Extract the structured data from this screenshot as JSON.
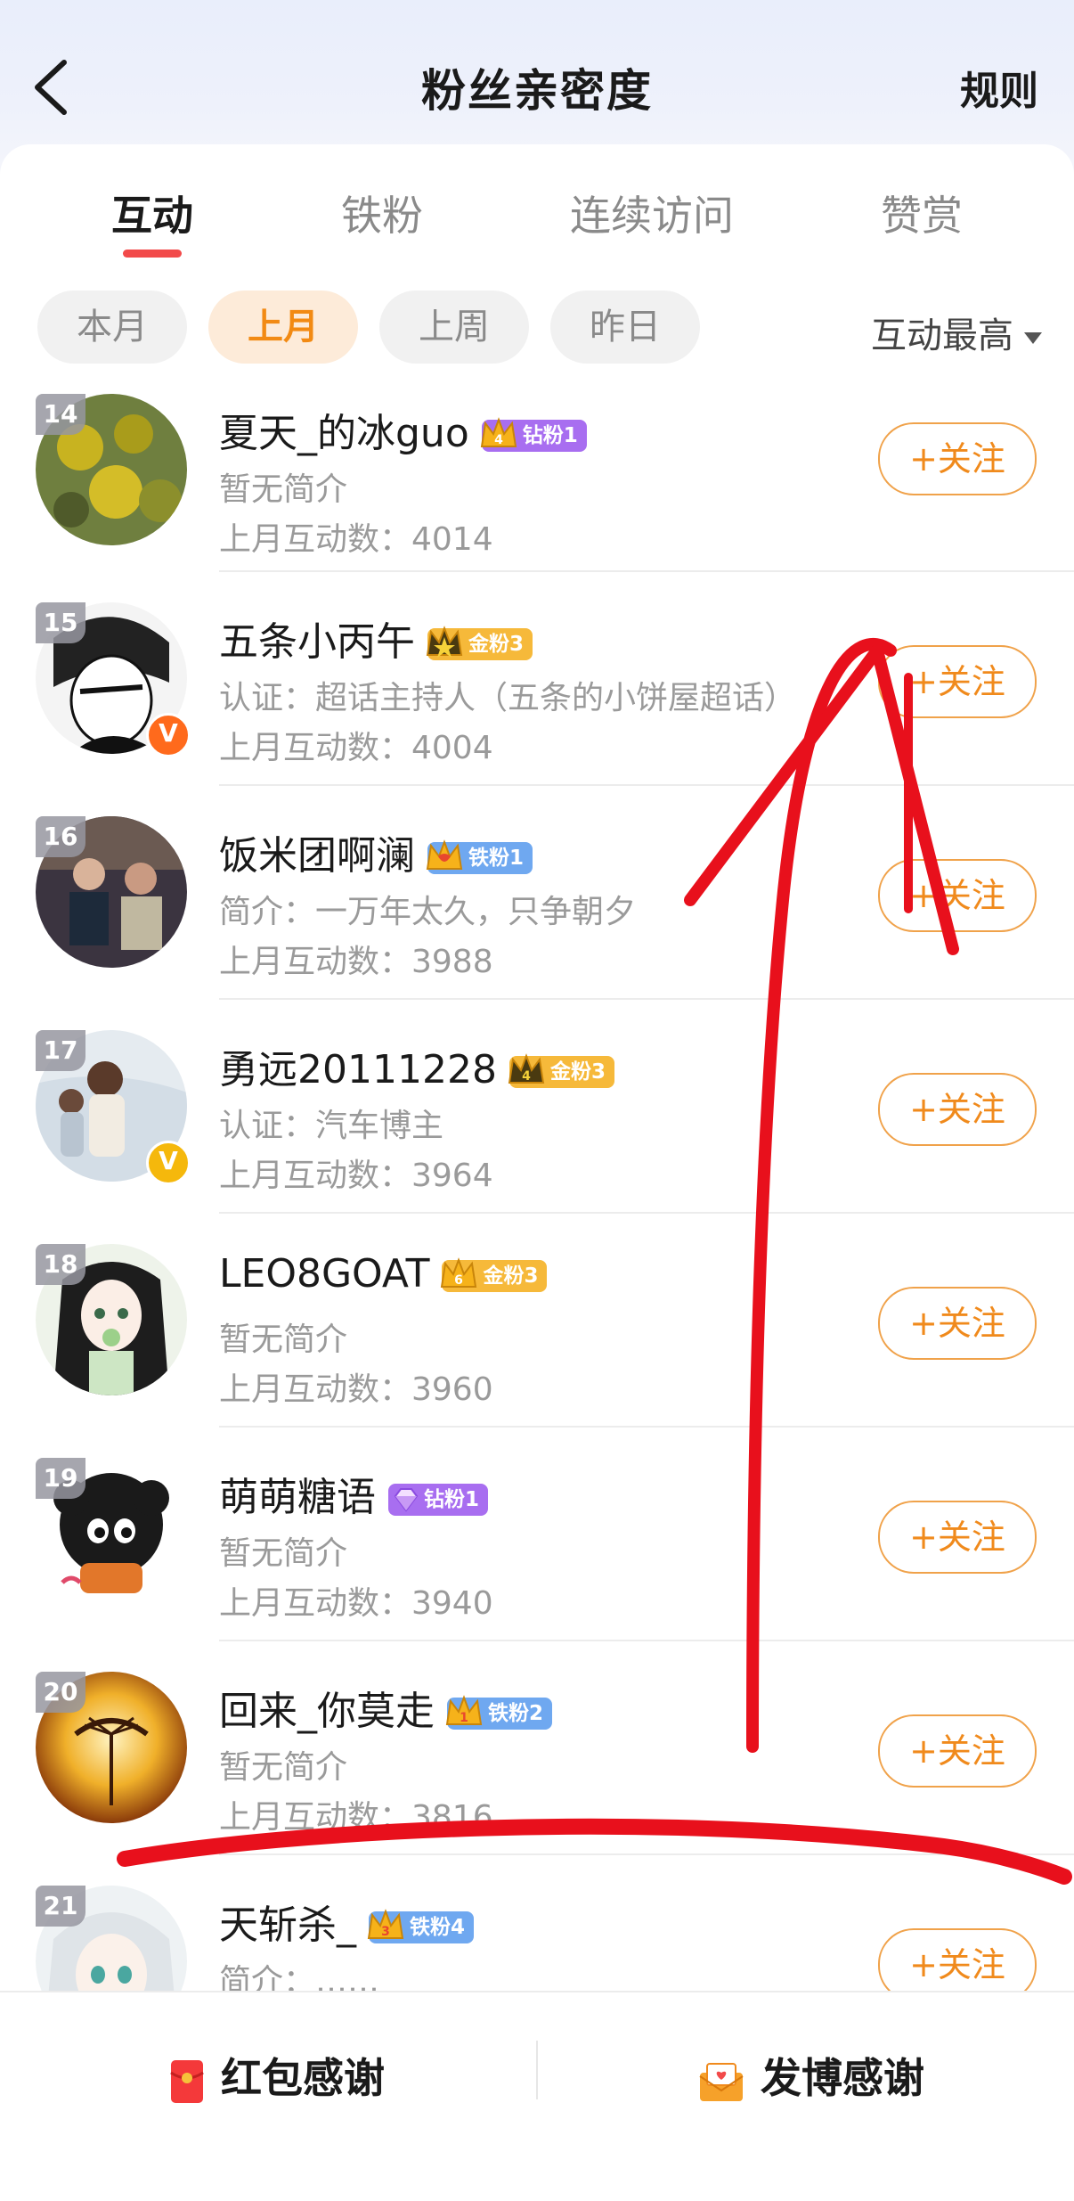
{
  "header": {
    "title": "粉丝亲密度",
    "rules_label": "规则"
  },
  "tabs": [
    {
      "label": "互动",
      "active": true
    },
    {
      "label": "铁粉",
      "active": false
    },
    {
      "label": "连续访问",
      "active": false
    },
    {
      "label": "赞赏",
      "active": false
    }
  ],
  "filters": [
    {
      "label": "本月",
      "active": false
    },
    {
      "label": "上月",
      "active": true
    },
    {
      "label": "上周",
      "active": false
    },
    {
      "label": "昨日",
      "active": false
    }
  ],
  "sort_label": "互动最高",
  "follow_label": "+关注",
  "fans": [
    {
      "rank": "14",
      "name": "夏天_的冰guo",
      "badge": "钻粉1",
      "badge_level": "4",
      "badge_color": "#a86ef0",
      "bio": "暂无简介",
      "count": "上月互动数：4014",
      "verified": "",
      "verified_color": ""
    },
    {
      "rank": "15",
      "name": "五条小丙午",
      "badge": "金粉3",
      "badge_level": "",
      "badge_color": "#f6b93a",
      "bio": "认证：超话主持人（五条的小饼屋超话）",
      "count": "上月互动数：4004",
      "verified": "V",
      "verified_color": "#ff6a1c"
    },
    {
      "rank": "16",
      "name": "饭米团啊澜",
      "badge": "铁粉1",
      "badge_level": "",
      "badge_color": "#6fa8f0",
      "bio": "简介：一万年太久，只争朝夕",
      "count": "上月互动数：3988",
      "verified": "",
      "verified_color": ""
    },
    {
      "rank": "17",
      "name": "勇远20111228",
      "badge": "金粉3",
      "badge_level": "4",
      "badge_color": "#f6b93a",
      "bio": "认证：汽车博主",
      "count": "上月互动数：3964",
      "verified": "V",
      "verified_color": "#f5b80c"
    },
    {
      "rank": "18",
      "name": "LEO8GOAT",
      "badge": "金粉3",
      "badge_level": "6",
      "badge_color": "#f6b93a",
      "bio": "暂无简介",
      "count": "上月互动数：3960",
      "verified": "",
      "verified_color": ""
    },
    {
      "rank": "19",
      "name": "萌萌糖语",
      "badge": "钻粉1",
      "badge_level": "",
      "badge_color": "#a86ef0",
      "bio": "暂无简介",
      "count": "上月互动数：3940",
      "verified": "",
      "verified_color": ""
    },
    {
      "rank": "20",
      "name": "回来_你莫走",
      "badge": "铁粉2",
      "badge_level": "1",
      "badge_color": "#6fa8f0",
      "bio": "暂无简介",
      "count": "上月互动数：3816",
      "verified": "",
      "verified_color": ""
    },
    {
      "rank": "21",
      "name": "天斩杀_",
      "badge": "铁粉4",
      "badge_level": "3",
      "badge_color": "#6fa8f0",
      "bio": "简介：……",
      "count": "",
      "verified": "",
      "verified_color": ""
    }
  ],
  "bottom": {
    "red_packet_label": "红包感谢",
    "post_label": "发博感谢"
  },
  "colors": {
    "accent": "#f24a4a",
    "orange": "#f08a1c",
    "annotation": "#e8101c"
  }
}
